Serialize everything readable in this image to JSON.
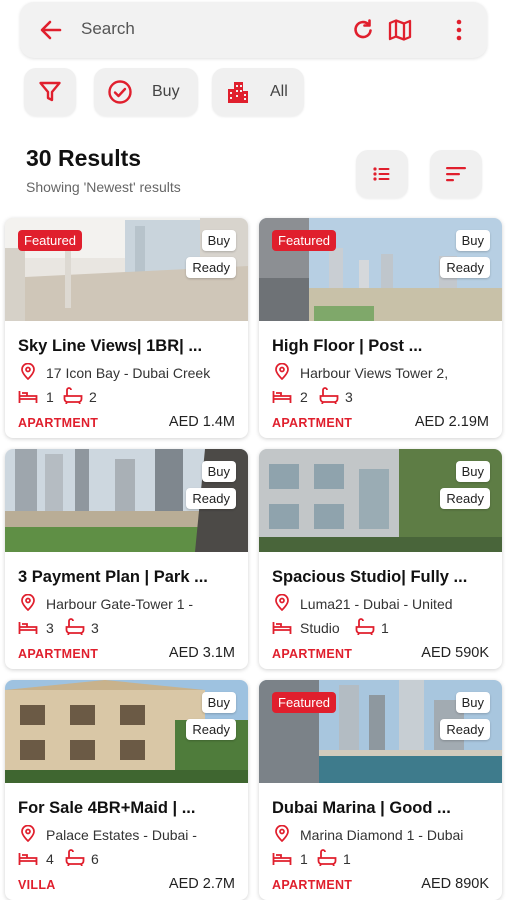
{
  "search": {
    "placeholder": "Search"
  },
  "chips": {
    "buy": "Buy",
    "all": "All"
  },
  "results": {
    "title": "30 Results",
    "subtitle": "Showing 'Newest' results"
  },
  "colors": {
    "accent": "#e01f2d",
    "chip_bg": "#f0f0f0"
  },
  "icons": {
    "back": "arrow-left-icon",
    "refresh": "refresh-icon",
    "map": "map-icon",
    "more": "more-vertical-icon",
    "filter": "filter-icon",
    "buy": "check-circle-icon",
    "all": "buildings-icon",
    "list": "list-icon",
    "sort": "sort-icon",
    "location": "location-pin-icon",
    "bed": "bed-icon",
    "bath": "bath-icon"
  },
  "listings": [
    {
      "featured": "Featured",
      "buy": "Buy",
      "ready": "Ready",
      "title": "Sky Line Views| 1BR| ...",
      "location": "17 Icon Bay - Dubai Creek",
      "beds": "1",
      "baths": "2",
      "type": "APARTMENT",
      "price": "AED 1.4M"
    },
    {
      "featured": "Featured",
      "buy": "Buy",
      "ready": "Ready",
      "title": "High Floor | Post ...",
      "location": "Harbour Views Tower 2,",
      "beds": "2",
      "baths": "3",
      "type": "APARTMENT",
      "price": "AED 2.19M"
    },
    {
      "featured": "",
      "buy": "Buy",
      "ready": "Ready",
      "title": "3 Payment Plan | Park ...",
      "location": "Harbour Gate-Tower 1 -",
      "beds": "3",
      "baths": "3",
      "type": "APARTMENT",
      "price": "AED 3.1M"
    },
    {
      "featured": "",
      "buy": "Buy",
      "ready": "Ready",
      "title": "Spacious Studio| Fully ...",
      "location": "Luma21 - Dubai - United",
      "beds": "Studio",
      "baths": "1",
      "type": "APARTMENT",
      "price": "AED 590K"
    },
    {
      "featured": "",
      "buy": "Buy",
      "ready": "Ready",
      "title": "For Sale 4BR+Maid | ...",
      "location": "Palace Estates - Dubai -",
      "beds": "4",
      "baths": "6",
      "type": "VILLA",
      "price": "AED 2.7M"
    },
    {
      "featured": "Featured",
      "buy": "Buy",
      "ready": "Ready",
      "title": "Dubai Marina | Good ...",
      "location": "Marina Diamond 1 - Dubai",
      "beds": "1",
      "baths": "1",
      "type": "APARTMENT",
      "price": "AED 890K"
    }
  ]
}
